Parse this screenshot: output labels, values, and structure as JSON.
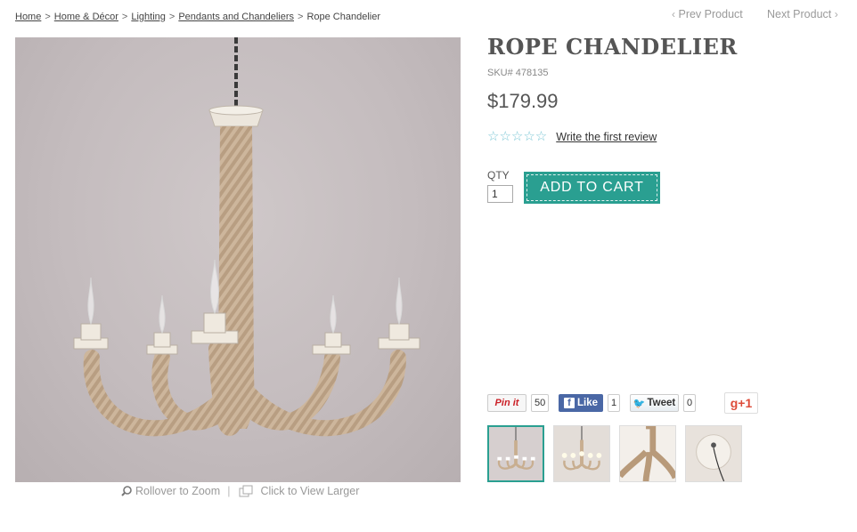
{
  "breadcrumb": {
    "items": [
      "Home",
      "Home & Décor",
      "Lighting",
      "Pendants and Chandeliers"
    ],
    "current": "Rope Chandelier",
    "separator": ">"
  },
  "pager": {
    "prev_label": "Prev Product",
    "next_label": "Next Product",
    "prev_icon": "‹",
    "next_icon": "›"
  },
  "product": {
    "title": "ROPE CHANDELIER",
    "sku": "SKU# 478135",
    "price": "$179.99",
    "stars": "☆☆☆☆☆",
    "review_link": "Write the first review",
    "qty_label": "QTY",
    "qty_value": "1",
    "add_to_cart": "ADD TO CART"
  },
  "image_tools": {
    "zoom_label": "Rollover to Zoom",
    "divider": "|",
    "larger_label": "Click to View Larger"
  },
  "social": {
    "pin_label": "Pin it",
    "pin_count": "50",
    "fb_icon": "f",
    "fb_label": "Like",
    "fb_count": "1",
    "tw_icon": "🐦",
    "tw_label": "Tweet",
    "tw_count": "0",
    "gplus_label": "g+1"
  },
  "colors": {
    "accent": "#2a9f91",
    "stars": "#7ec8d6",
    "facebook": "#4a67a5",
    "pinterest": "#cb2027",
    "gplus": "#dd4b39"
  }
}
